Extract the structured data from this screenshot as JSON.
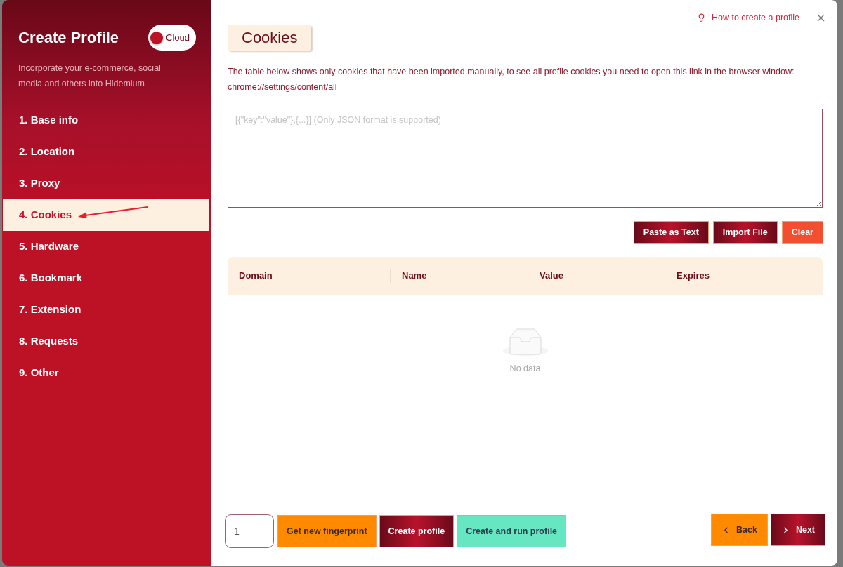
{
  "sidebar": {
    "title": "Create Profile",
    "cloud_toggle": {
      "label": "Cloud",
      "on": false
    },
    "subtitle": "Incorporate your e-commerce, social media and others into Hidemium",
    "items": [
      {
        "label": "1. Base info",
        "selected": false
      },
      {
        "label": "2. Location",
        "selected": false
      },
      {
        "label": "3. Proxy",
        "selected": false
      },
      {
        "label": "4. Cookies",
        "selected": true
      },
      {
        "label": "5. Hardware",
        "selected": false
      },
      {
        "label": "6. Bookmark",
        "selected": false
      },
      {
        "label": "7. Extension",
        "selected": false
      },
      {
        "label": "8. Requests",
        "selected": false
      },
      {
        "label": "9. Other",
        "selected": false
      }
    ]
  },
  "header": {
    "help_link": "How to create a profile"
  },
  "section": {
    "title": "Cookies",
    "description": "The table below shows only cookies that have been imported manually, to see all profile cookies you need to open this link in the browser window: chrome://settings/content/all",
    "cookie_input": {
      "placeholder": "[{\"key\":\"value\"},{...}] (Only JSON format is supported)"
    },
    "buttons": [
      {
        "label": "Paste as Text",
        "kind": "dark"
      },
      {
        "label": "Import File",
        "kind": "dark"
      },
      {
        "label": "Clear",
        "kind": "danger"
      }
    ]
  },
  "table": {
    "columns": [
      "Domain",
      "Name",
      "Value",
      "Expires"
    ],
    "empty_text": "No data"
  },
  "footer": {
    "count_input": {
      "value": "1"
    },
    "actions": [
      {
        "label": "Get new fingerprint",
        "kind": "orange"
      },
      {
        "label": "Create profile",
        "kind": "dark"
      },
      {
        "label": "Create and run profile",
        "kind": "teal"
      }
    ],
    "nav": [
      {
        "label": "Back",
        "kind": "back"
      },
      {
        "label": "Next",
        "kind": "next"
      }
    ]
  }
}
